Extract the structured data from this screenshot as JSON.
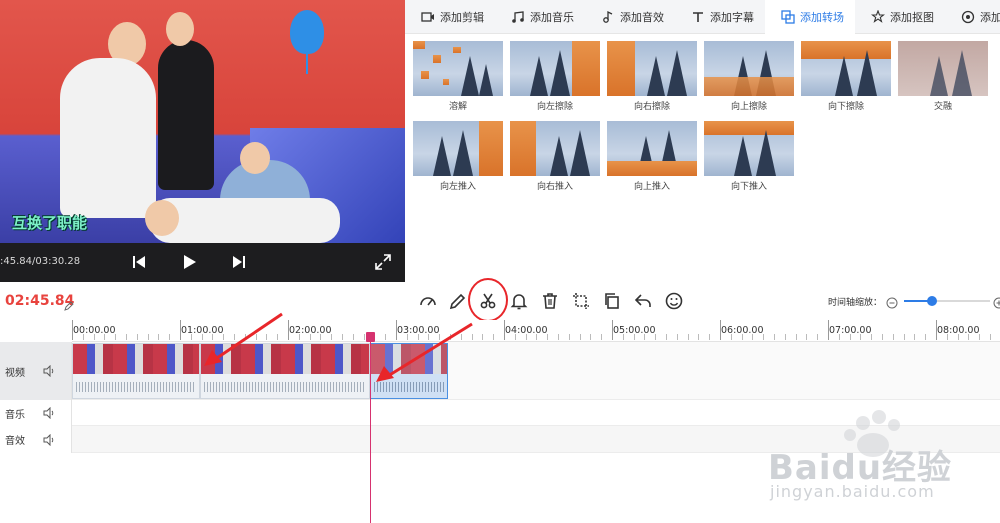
{
  "preview": {
    "caption": "互换了职能",
    "time": ":45.84/03:30.28"
  },
  "tabs": [
    {
      "label": "添加剪辑",
      "icon": "film-icon"
    },
    {
      "label": "添加音乐",
      "icon": "music-icon"
    },
    {
      "label": "添加音效",
      "icon": "sound-effect-icon"
    },
    {
      "label": "添加字幕",
      "icon": "text-icon"
    },
    {
      "label": "添加转场",
      "icon": "transition-icon",
      "active": true
    },
    {
      "label": "添加抠图",
      "icon": "cutout-icon"
    },
    {
      "label": "添加滤镜",
      "icon": "filter-icon"
    }
  ],
  "transitions": [
    {
      "name": "溶解"
    },
    {
      "name": "向左擦除"
    },
    {
      "name": "向右擦除"
    },
    {
      "name": "向上擦除"
    },
    {
      "name": "向下擦除"
    },
    {
      "name": "交融"
    },
    {
      "name": "向左推入"
    },
    {
      "name": "向右推入"
    },
    {
      "name": "向上推入"
    },
    {
      "name": "向下推入"
    }
  ],
  "toolbar": {
    "current_time": "02:45.84",
    "tools": [
      "speed-icon",
      "edit-pen-icon",
      "scissors-icon",
      "bell-icon",
      "trash-icon",
      "crop-icon",
      "copy-icon",
      "undo-icon",
      "emoji-icon"
    ],
    "zoom_label": "时间轴缩放：",
    "zoom_level": 0.33
  },
  "timeline": {
    "ticks": [
      "00:00.00",
      "01:00.00",
      "02:00.00",
      "03:00.00",
      "04:00.00",
      "05:00.00",
      "06:00.00",
      "07:00.00",
      "08:00.00"
    ],
    "tracks": [
      {
        "label": "视频"
      },
      {
        "label": "音乐"
      },
      {
        "label": "音效"
      }
    ]
  },
  "watermark": {
    "logo": "Baidu经验",
    "url": "jingyan.baidu.com"
  },
  "colors": {
    "accent": "#2d7ce6",
    "time_red": "#e8433e",
    "playhead": "#d6326f",
    "annotation_red": "#e8262a"
  }
}
